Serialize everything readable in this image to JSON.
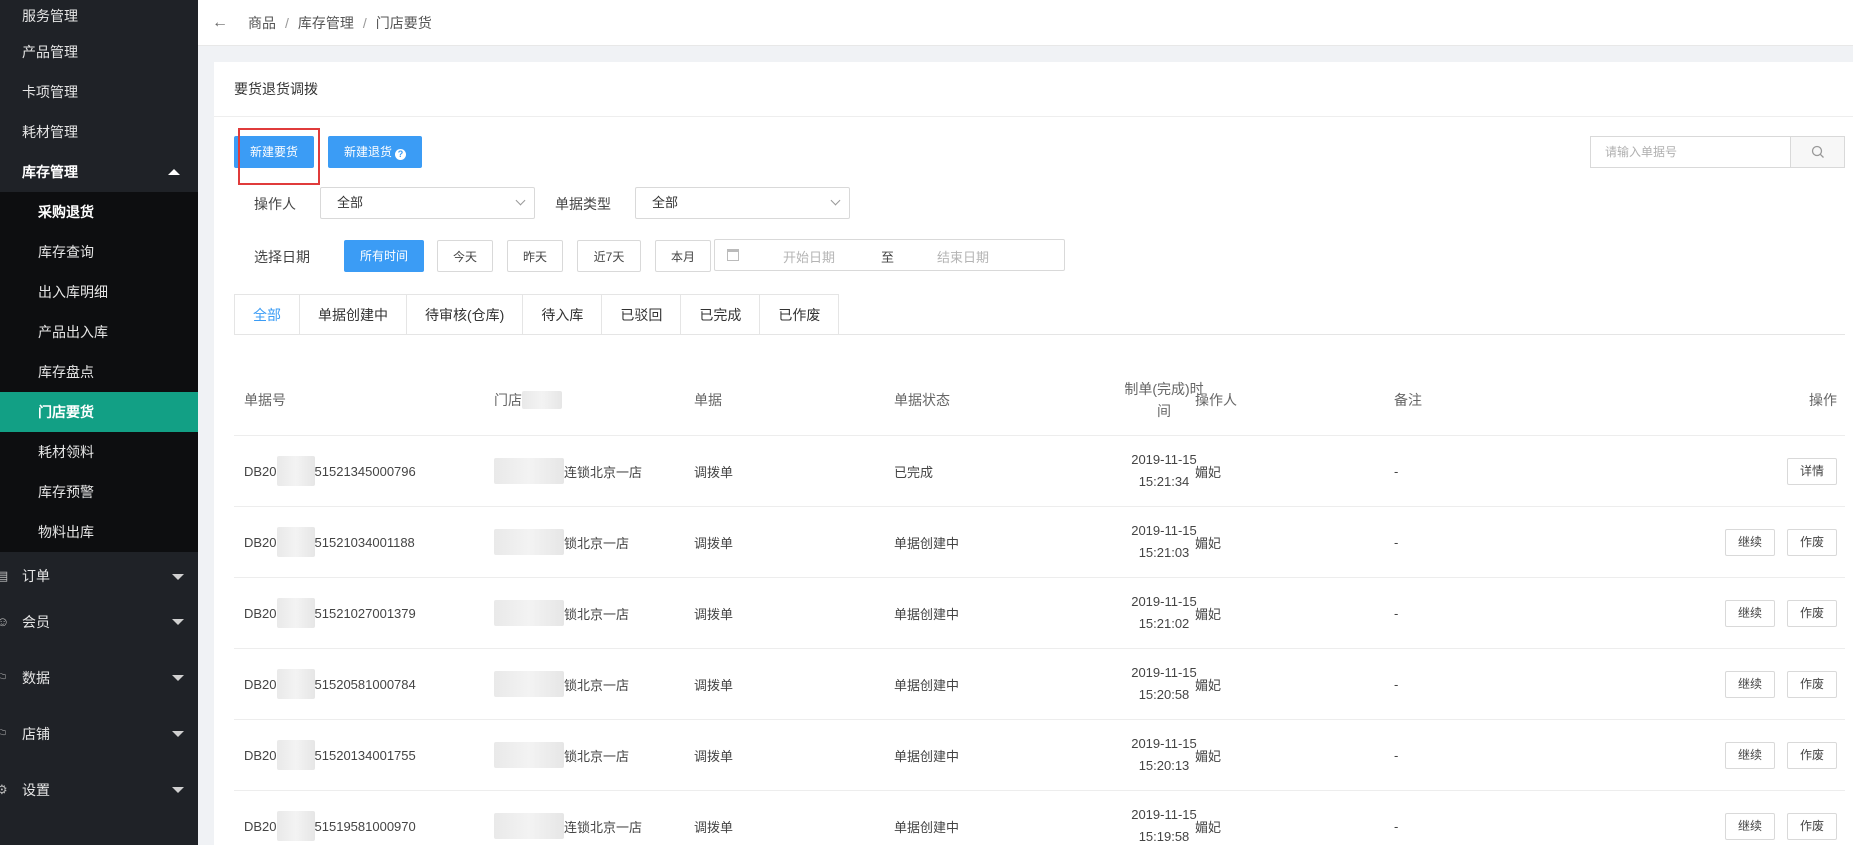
{
  "sidebar": {
    "top_items": [
      "服务管理",
      "产品管理",
      "卡项管理",
      "耗材管理"
    ],
    "open_group": "库存管理",
    "sub_items": [
      "采购退货",
      "库存查询",
      "出入库明细",
      "产品出入库",
      "库存盘点",
      "门店要货",
      "耗材领料",
      "库存预警",
      "物料出库"
    ],
    "active_sub": "门店要货",
    "groups": [
      {
        "label": "订单",
        "icon": "order-icon"
      },
      {
        "label": "会员",
        "icon": "member-icon"
      },
      {
        "label": "数据",
        "icon": "flag-icon"
      },
      {
        "label": "店铺",
        "icon": "flag-icon"
      },
      {
        "label": "设置",
        "icon": "gear-icon"
      }
    ]
  },
  "breadcrumb": {
    "items": [
      "商品",
      "库存管理",
      "门店要货"
    ],
    "separator": "/"
  },
  "page": {
    "title": "要货退货调拨"
  },
  "actions": {
    "new_request": "新建要货",
    "new_return": "新建退货",
    "help_glyph": "?"
  },
  "search": {
    "placeholder": "请输入单据号"
  },
  "filters": {
    "operator_label": "操作人",
    "operator_value": "全部",
    "doc_type_label": "单据类型",
    "doc_type_value": "全部",
    "date_label": "选择日期",
    "date_options": [
      "所有时间",
      "今天",
      "昨天",
      "近7天",
      "本月"
    ],
    "date_selected": "所有时间",
    "start_placeholder": "开始日期",
    "range_sep": "至",
    "end_placeholder": "结束日期"
  },
  "tabs": [
    "全部",
    "单据创建中",
    "待审核(仓库)",
    "待入库",
    "已驳回",
    "已完成",
    "已作废"
  ],
  "active_tab": "全部",
  "table": {
    "headers": {
      "no": "单据号",
      "store": "门店",
      "type": "单据",
      "status": "单据状态",
      "time_line1": "制单(完成)时",
      "time_line2": "间",
      "operator": "操作人",
      "note": "备注",
      "action": "操作"
    },
    "rows": [
      {
        "no_prefix": "DB20",
        "no_suffix": "51521345000796",
        "store_suffix": "连锁北京一店",
        "type": "调拨单",
        "status": "已完成",
        "date": "2019-11-15",
        "time": "15:21:34",
        "operator": "媚妃",
        "note": "-",
        "actions": [
          "详情"
        ]
      },
      {
        "no_prefix": "DB20",
        "no_suffix": "51521034001188",
        "store_suffix": "锁北京一店",
        "type": "调拨单",
        "status": "单据创建中",
        "date": "2019-11-15",
        "time": "15:21:03",
        "operator": "媚妃",
        "note": "-",
        "actions": [
          "继续",
          "作废"
        ]
      },
      {
        "no_prefix": "DB20",
        "no_suffix": "51521027001379",
        "store_suffix": "锁北京一店",
        "type": "调拨单",
        "status": "单据创建中",
        "date": "2019-11-15",
        "time": "15:21:02",
        "operator": "媚妃",
        "note": "-",
        "actions": [
          "继续",
          "作废"
        ]
      },
      {
        "no_prefix": "DB20",
        "no_suffix": "51520581000784",
        "store_suffix": "锁北京一店",
        "type": "调拨单",
        "status": "单据创建中",
        "date": "2019-11-15",
        "time": "15:20:58",
        "operator": "媚妃",
        "note": "-",
        "actions": [
          "继续",
          "作废"
        ]
      },
      {
        "no_prefix": "DB20",
        "no_suffix": "51520134001755",
        "store_suffix": "锁北京一店",
        "type": "调拨单",
        "status": "单据创建中",
        "date": "2019-11-15",
        "time": "15:20:13",
        "operator": "媚妃",
        "note": "-",
        "actions": [
          "继续",
          "作废"
        ]
      },
      {
        "no_prefix": "DB20",
        "no_suffix": "51519581000970",
        "store_suffix": "连锁北京一店",
        "type": "调拨单",
        "status": "单据创建中",
        "date": "2019-11-15",
        "time": "15:19:58",
        "operator": "媚妃",
        "note": "-",
        "actions": [
          "继续",
          "作废"
        ]
      }
    ]
  }
}
